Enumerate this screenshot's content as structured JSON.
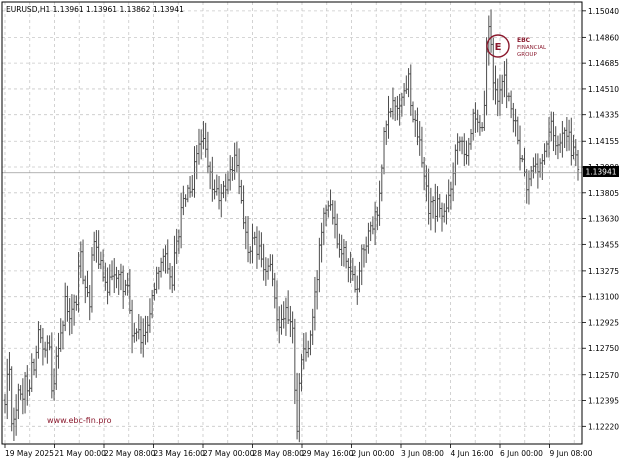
{
  "header": {
    "symbol_text": "EURUSD,H1  1.13961 1.13961 1.13862 1.13941"
  },
  "watermark": {
    "brand_letters": "EBC",
    "brand_line1": "FINANCIAL",
    "brand_line2": "GROUP",
    "url_text": "www.ebc-fin.pro",
    "brand_color": "#8b1a2e"
  },
  "colors": {
    "bars": "#4d4d4d",
    "grid": "#c8c8c8",
    "price_tag_bg": "#000000",
    "price_tag_text": "#ffffff"
  },
  "chart_data": {
    "type": "bar",
    "style": "ohlc-bars",
    "symbol": "EURUSD",
    "timeframe": "H1",
    "grid": true,
    "y_range": [
      1.121,
      1.151
    ],
    "y_ticks": [
      "1.15040",
      "1.14860",
      "1.14685",
      "1.14510",
      "1.14335",
      "1.14155",
      "1.13980",
      "1.13805",
      "1.13630",
      "1.13455",
      "1.13275",
      "1.13100",
      "1.12925",
      "1.12750",
      "1.12570",
      "1.12395",
      "1.12220"
    ],
    "x_ticks": [
      "19 May 2025",
      "21 May 00:00",
      "22 May 08:00",
      "23 May 16:00",
      "27 May 00:00",
      "28 May 08:00",
      "29 May 16:00",
      "2 Jun 00:00",
      "3 Jun 08:00",
      "4 Jun 16:00",
      "6 Jun 00:00",
      "9 Jun 08:00"
    ],
    "last_price": "1.13941",
    "last_ohlc": {
      "open": 1.13961,
      "high": 1.13961,
      "low": 1.13862,
      "close": 1.13941
    },
    "path_points": [
      [
        1.1235,
        1.1272
      ],
      [
        1.1228,
        1.1228
      ],
      [
        1.125,
        1.1232
      ],
      [
        1.1255,
        1.1248
      ],
      [
        1.1265,
        1.1265
      ],
      [
        1.129,
        1.127
      ],
      [
        1.1272,
        1.1278
      ],
      [
        1.1238,
        1.1272
      ],
      [
        1.1282,
        1.129
      ],
      [
        1.131,
        1.1292
      ],
      [
        1.1302,
        1.1305
      ],
      [
        1.1342,
        1.1325
      ],
      [
        1.1318,
        1.1305
      ],
      [
        1.1348,
        1.134
      ],
      [
        1.1335,
        1.132
      ],
      [
        1.1312,
        1.1328
      ],
      [
        1.133,
        1.1318
      ],
      [
        1.1328,
        1.1312
      ],
      [
        1.1325,
        1.129
      ],
      [
        1.1282,
        1.1286
      ],
      [
        1.1278,
        1.1288
      ],
      [
        1.1292,
        1.1302
      ],
      [
        1.1318,
        1.133
      ],
      [
        1.1335,
        1.134
      ],
      [
        1.1325,
        1.1315
      ],
      [
        1.1338,
        1.135
      ],
      [
        1.1368,
        1.1375
      ],
      [
        1.1385,
        1.1372
      ],
      [
        1.14,
        1.1412
      ],
      [
        1.142,
        1.1408
      ],
      [
        1.1395,
        1.1385
      ],
      [
        1.1382,
        1.1378
      ],
      [
        1.1378,
        1.1385
      ],
      [
        1.1392,
        1.1398
      ],
      [
        1.1405,
        1.1385
      ],
      [
        1.1372,
        1.1352
      ],
      [
        1.1335,
        1.1345
      ],
      [
        1.1345,
        1.134
      ],
      [
        1.133,
        1.1325
      ],
      [
        1.1332,
        1.1318
      ],
      [
        1.1302,
        1.1292
      ],
      [
        1.13,
        1.1298
      ],
      [
        1.129,
        1.1285
      ],
      [
        1.1215,
        1.126
      ],
      [
        1.1275,
        1.1272
      ],
      [
        1.128,
        1.13
      ],
      [
        1.1322,
        1.1352
      ],
      [
        1.137,
        1.1375
      ],
      [
        1.1375,
        1.1365
      ],
      [
        1.135,
        1.1345
      ],
      [
        1.134,
        1.1338
      ],
      [
        1.1325,
        1.132
      ],
      [
        1.1318,
        1.134
      ],
      [
        1.1345,
        1.135
      ],
      [
        1.1355,
        1.1362
      ],
      [
        1.1368,
        1.1392
      ],
      [
        1.1425,
        1.143
      ],
      [
        1.144,
        1.144
      ],
      [
        1.144,
        1.1445
      ],
      [
        1.145,
        1.146
      ],
      [
        1.1438,
        1.1425
      ],
      [
        1.1415,
        1.1405
      ],
      [
        1.1385,
        1.137
      ],
      [
        1.1372,
        1.1368
      ],
      [
        1.1375,
        1.1362
      ],
      [
        1.1368,
        1.1378
      ],
      [
        1.1395,
        1.141
      ],
      [
        1.1422,
        1.1415
      ],
      [
        1.1408,
        1.1418
      ],
      [
        1.143,
        1.1425
      ],
      [
        1.142,
        1.1425
      ],
      [
        1.147,
        1.1498
      ],
      [
        1.1455,
        1.1445
      ],
      [
        1.1452,
        1.1458
      ],
      [
        1.145,
        1.144
      ],
      [
        1.143,
        1.142
      ],
      [
        1.1405,
        1.1395
      ],
      [
        1.1382,
        1.1392
      ],
      [
        1.1402,
        1.1395
      ],
      [
        1.14,
        1.1405
      ],
      [
        1.142,
        1.1425
      ],
      [
        1.142,
        1.141
      ],
      [
        1.1422,
        1.1428
      ],
      [
        1.142,
        1.141
      ],
      [
        1.1408,
        1.1394
      ]
    ]
  }
}
